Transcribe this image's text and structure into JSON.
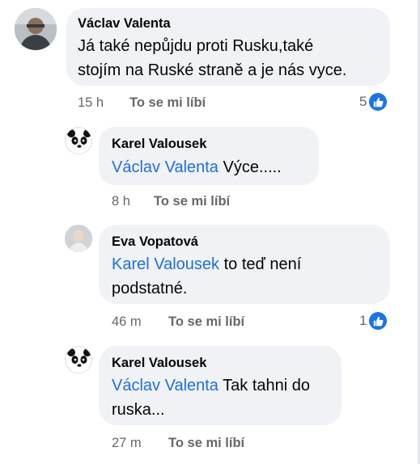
{
  "comments": [
    {
      "author": "Václav Valenta",
      "mention": "",
      "text_line1": "Já také nepůjdu proti Rusku,také",
      "text_line2": "stojím na Ruské straně a je nás vyce.",
      "time": "15 h",
      "like_label": "To se mi líbí",
      "reaction_count": "5",
      "avatar_icon": "profile-photo"
    },
    {
      "author": "Karel Valousek",
      "mention": "Václav Valenta",
      "text_line1": " Výce.....",
      "text_line2": "",
      "time": "8 h",
      "like_label": "To se mi líbí",
      "reaction_count": "",
      "avatar_icon": "panda-avatar"
    },
    {
      "author": "Eva Vopatová",
      "mention": "Karel Valousek",
      "text_line1": " to teď není",
      "text_line2": "podstatné.",
      "time": "46 m",
      "like_label": "To se mi líbí",
      "reaction_count": "1",
      "avatar_icon": "profile-photo"
    },
    {
      "author": "Karel Valousek",
      "mention": "Václav Valenta",
      "text_line1": " Tak tahni do",
      "text_line2": "ruska...",
      "time": "27 m",
      "like_label": "To se mi líbí",
      "reaction_count": "",
      "avatar_icon": "panda-avatar"
    }
  ],
  "colors": {
    "bubble": "#f0f2f5",
    "mention": "#216fdb",
    "meta": "#65676b",
    "like_badge": "#1b74e4"
  }
}
